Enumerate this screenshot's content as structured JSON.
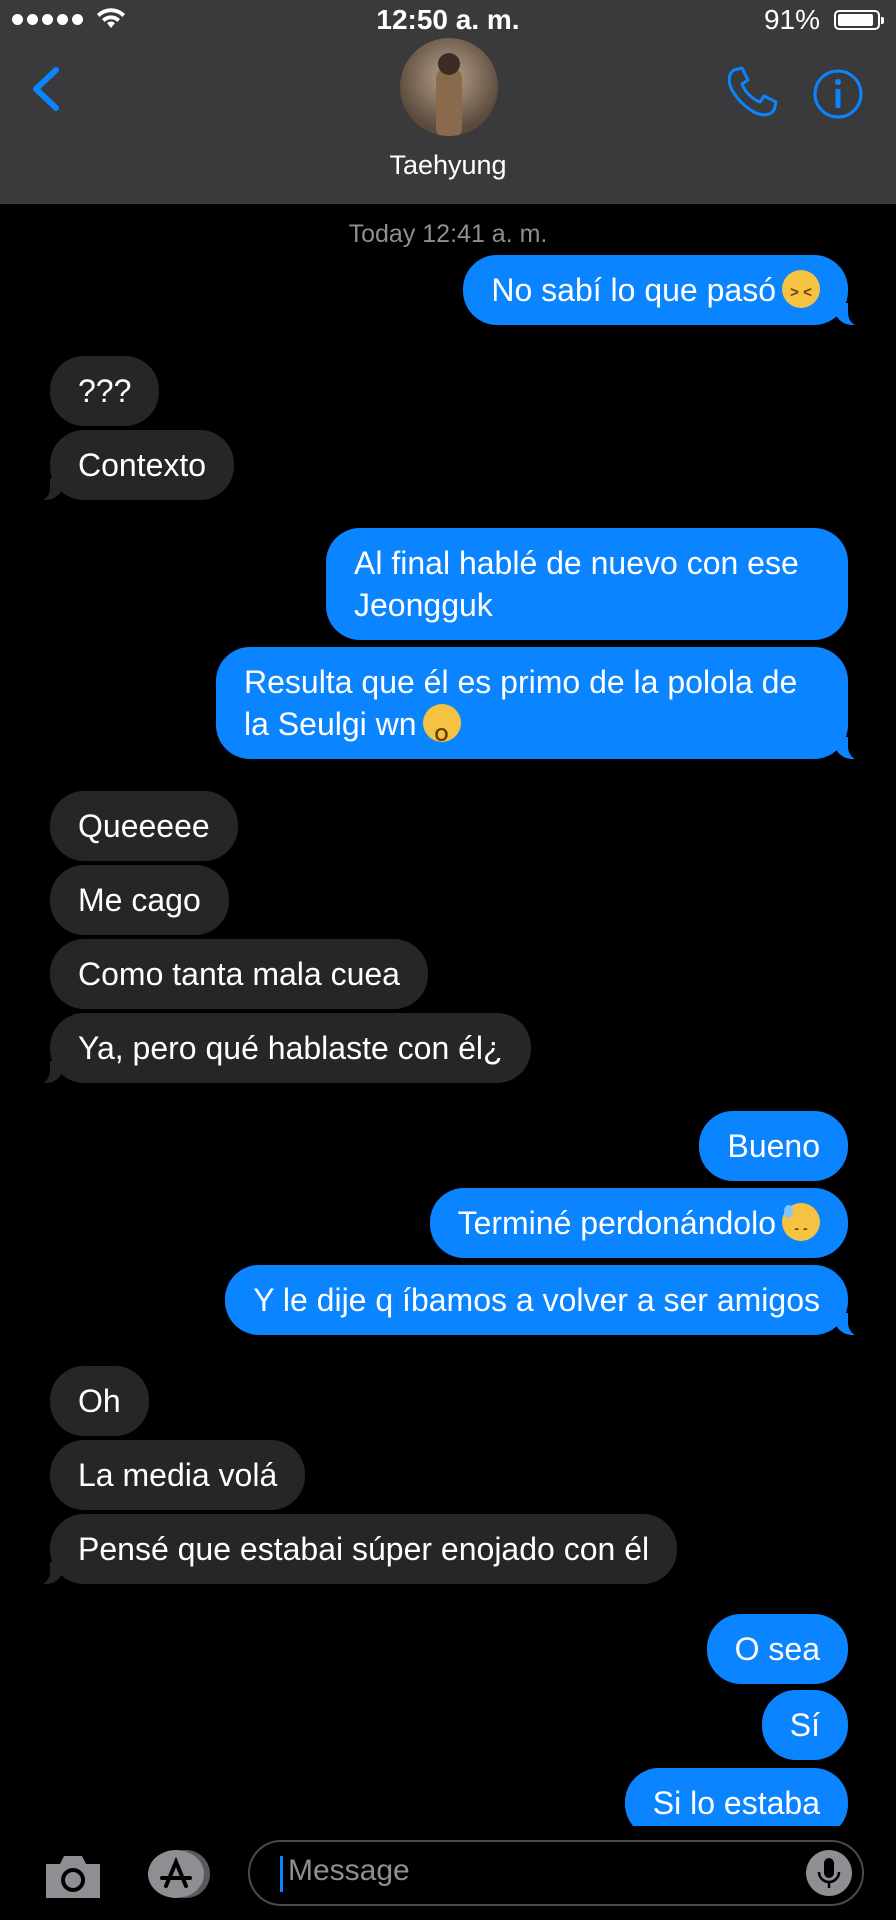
{
  "status_bar": {
    "time": "12:50 a. m.",
    "battery_percent": "91%",
    "battery_level": 0.91,
    "signal_bars": 5
  },
  "header": {
    "contact_name": "Taehyung",
    "back_icon": "chevron-left-icon",
    "call_icon": "phone-icon",
    "info_icon": "info-icon",
    "accent_color": "#0a84ff"
  },
  "conversation": {
    "timestamp": "Today 12:41 a. m.",
    "messages": [
      {
        "from": "me",
        "text": "No sabí lo que pasó",
        "emoji": "confounded-face"
      },
      {
        "from": "them",
        "text": "???"
      },
      {
        "from": "them",
        "text": "Contexto"
      },
      {
        "from": "me",
        "text": "Al final hablé de nuevo con ese Jeongguk"
      },
      {
        "from": "me",
        "text": "Resulta que él es primo de la polola de la Seulgi wn",
        "emoji": "screaming-cat-face"
      },
      {
        "from": "them",
        "text": "Queeeee"
      },
      {
        "from": "them",
        "text": "Me cago"
      },
      {
        "from": "them",
        "text": "Como tanta mala cuea"
      },
      {
        "from": "them",
        "text": "Ya, pero qué hablaste con él¿"
      },
      {
        "from": "me",
        "text": "Bueno"
      },
      {
        "from": "me",
        "text": "Terminé perdonándolo",
        "emoji": "downcast-sweat-face"
      },
      {
        "from": "me",
        "text": "Y le dije q íbamos a volver a ser amigos"
      },
      {
        "from": "them",
        "text": "Oh"
      },
      {
        "from": "them",
        "text": "La media volá"
      },
      {
        "from": "them",
        "text": "Pensé que estabai súper enojado con él"
      },
      {
        "from": "me",
        "text": "O sea"
      },
      {
        "from": "me",
        "text": "Sí"
      },
      {
        "from": "me",
        "text": "Si lo estaba"
      }
    ]
  },
  "input_bar": {
    "placeholder": "Message",
    "camera_icon": "camera-icon",
    "apps_icon": "app-store-icon",
    "mic_icon": "microphone-icon"
  },
  "colors": {
    "outgoing_bubble": "#0a84ff",
    "incoming_bubble": "#262628",
    "header_bg": "#3a3a3c"
  }
}
